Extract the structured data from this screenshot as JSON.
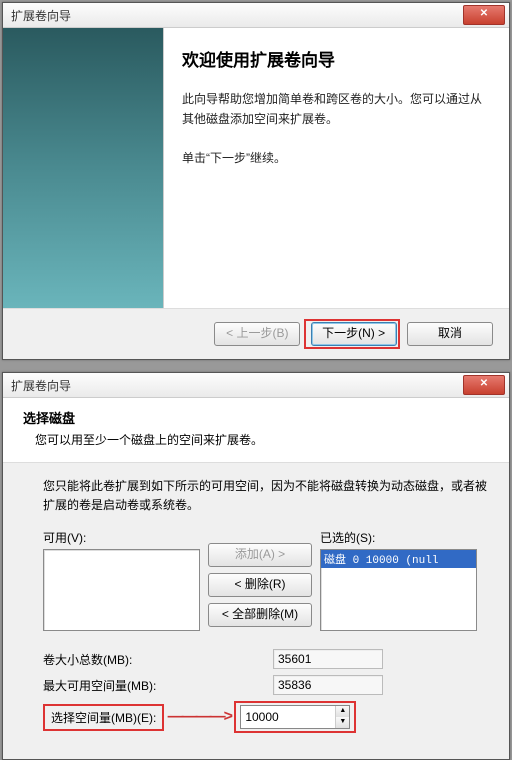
{
  "dialog1": {
    "title": "扩展卷向导",
    "close": "✕",
    "heading": "欢迎使用扩展卷向导",
    "para1": "此向导帮助您增加简单卷和跨区卷的大小。您可以通过从其他磁盘添加空间来扩展卷。",
    "para2": "单击“下一步”继续。",
    "btn_back": "< 上一步(B)",
    "btn_next": "下一步(N) >",
    "btn_cancel": "取消"
  },
  "dialog2": {
    "title": "扩展卷向导",
    "close": "✕",
    "header_title": "选择磁盘",
    "header_sub": "您可以用至少一个磁盘上的空间来扩展卷。",
    "note": "您只能将此卷扩展到如下所示的可用空间，因为不能将磁盘转换为动态磁盘，或者被扩展的卷是启动卷或系统卷。",
    "avail_label": "可用(V):",
    "selected_label": "已选的(S):",
    "btn_add": "添加(A) >",
    "btn_remove": "< 删除(R)",
    "btn_remove_all": "< 全部删除(M)",
    "selected_item": "磁盘 0      10000  (null",
    "row_total_label": "卷大小总数(MB):",
    "row_total_value": "35601",
    "row_max_label": "最大可用空间量(MB):",
    "row_max_value": "35836",
    "row_sel_label": "选择空间量(MB)(E):",
    "row_sel_value": "10000",
    "arrow": "————>"
  }
}
